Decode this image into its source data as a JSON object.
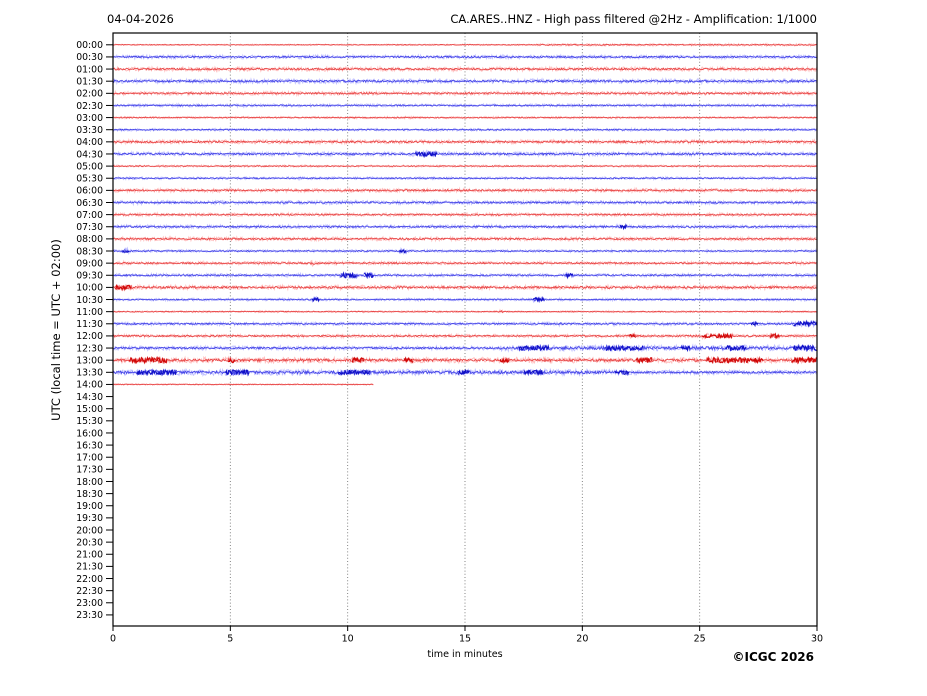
{
  "header": {
    "date": "04-04-2026",
    "title": "CA.ARES..HNZ - High pass filtered @2Hz - Amplification: 1/1000"
  },
  "axes": {
    "x_title": "time in minutes",
    "y_title": "UTC (local time = UTC + 02:00)",
    "x_ticks": [
      "0",
      "5",
      "10",
      "15",
      "20",
      "25",
      "30"
    ],
    "y_ticks": [
      "00:00",
      "00:30",
      "01:00",
      "01:30",
      "02:00",
      "02:30",
      "03:00",
      "03:30",
      "04:00",
      "04:30",
      "05:00",
      "05:30",
      "06:00",
      "06:30",
      "07:00",
      "07:30",
      "08:00",
      "08:30",
      "09:00",
      "09:30",
      "10:00",
      "10:30",
      "11:00",
      "11:30",
      "12:00",
      "12:30",
      "13:00",
      "13:30",
      "14:00",
      "14:30",
      "15:00",
      "15:30",
      "16:00",
      "16:30",
      "17:00",
      "17:30",
      "18:00",
      "18:30",
      "19:00",
      "19:30",
      "20:00",
      "20:30",
      "21:00",
      "21:30",
      "22:00",
      "22:30",
      "23:00",
      "23:30"
    ]
  },
  "footer": {
    "copyright": "©ICGC 2026"
  },
  "chart_data": {
    "type": "line",
    "subtype": "helicorder-seismogram",
    "title": "CA.ARES..HNZ - High pass filtered @2Hz - Amplification: 1/1000",
    "xlabel": "time in minutes",
    "ylabel": "UTC (local time = UTC + 02:00)",
    "x_range_minutes": [
      0,
      30
    ],
    "minutes_per_line": 30,
    "grid_minutes": [
      5,
      10,
      15,
      20,
      25
    ],
    "legend": "none",
    "colors": {
      "red": {
        "core": "#e84848",
        "halo": "#ffb0b0",
        "dark": "#cf0202"
      },
      "blue": {
        "core": "#4848e8",
        "halo": "#b0b0ff",
        "dark": "#0b0bc4"
      }
    },
    "rows": [
      {
        "time": "00:00",
        "color": "red",
        "end_min": 30,
        "noise": 0.4,
        "events": [
          [
            18,
            30,
            0.25
          ]
        ]
      },
      {
        "time": "00:30",
        "color": "blue",
        "end_min": 30,
        "noise": 1.0,
        "events": []
      },
      {
        "time": "01:00",
        "color": "red",
        "end_min": 30,
        "noise": 1.1,
        "events": []
      },
      {
        "time": "01:30",
        "color": "blue",
        "end_min": 30,
        "noise": 1.2,
        "events": []
      },
      {
        "time": "02:00",
        "color": "red",
        "end_min": 30,
        "noise": 1.0,
        "events": []
      },
      {
        "time": "02:30",
        "color": "blue",
        "end_min": 30,
        "noise": 0.8,
        "events": []
      },
      {
        "time": "03:00",
        "color": "red",
        "end_min": 30,
        "noise": 0.6,
        "events": []
      },
      {
        "time": "03:30",
        "color": "blue",
        "end_min": 30,
        "noise": 0.7,
        "events": []
      },
      {
        "time": "04:00",
        "color": "red",
        "end_min": 30,
        "noise": 1.1,
        "events": []
      },
      {
        "time": "04:30",
        "color": "blue",
        "end_min": 30,
        "noise": 1.1,
        "events": [
          [
            12.9,
            13.8,
            1.8
          ]
        ]
      },
      {
        "time": "05:00",
        "color": "red",
        "end_min": 30,
        "noise": 0.6,
        "events": []
      },
      {
        "time": "05:30",
        "color": "blue",
        "end_min": 30,
        "noise": 0.7,
        "events": []
      },
      {
        "time": "06:00",
        "color": "red",
        "end_min": 30,
        "noise": 1.0,
        "events": []
      },
      {
        "time": "06:30",
        "color": "blue",
        "end_min": 30,
        "noise": 1.0,
        "events": []
      },
      {
        "time": "07:00",
        "color": "red",
        "end_min": 30,
        "noise": 0.9,
        "events": []
      },
      {
        "time": "07:30",
        "color": "blue",
        "end_min": 30,
        "noise": 1.0,
        "events": [
          [
            21.6,
            21.9,
            1.3
          ]
        ]
      },
      {
        "time": "08:00",
        "color": "red",
        "end_min": 30,
        "noise": 1.0,
        "events": []
      },
      {
        "time": "08:30",
        "color": "blue",
        "end_min": 30,
        "noise": 0.7,
        "events": [
          [
            0.4,
            0.7,
            1.2
          ],
          [
            12.2,
            12.5,
            1.0
          ]
        ]
      },
      {
        "time": "09:00",
        "color": "red",
        "end_min": 30,
        "noise": 0.9,
        "events": [
          [
            8.4,
            8.6,
            0.8
          ]
        ]
      },
      {
        "time": "09:30",
        "color": "blue",
        "end_min": 30,
        "noise": 0.9,
        "events": [
          [
            9.7,
            10.4,
            2.0
          ],
          [
            10.7,
            11.1,
            1.4
          ],
          [
            19.3,
            19.6,
            1.3
          ]
        ]
      },
      {
        "time": "10:00",
        "color": "red",
        "end_min": 30,
        "noise": 1.2,
        "events": [
          [
            0.1,
            0.8,
            1.9
          ]
        ]
      },
      {
        "time": "10:30",
        "color": "blue",
        "end_min": 30,
        "noise": 0.7,
        "events": [
          [
            8.5,
            8.8,
            1.4
          ],
          [
            17.9,
            18.4,
            1.3
          ]
        ]
      },
      {
        "time": "11:00",
        "color": "red",
        "end_min": 30,
        "noise": 0.5,
        "events": [
          [
            16.4,
            16.6,
            0.7
          ]
        ]
      },
      {
        "time": "11:30",
        "color": "blue",
        "end_min": 30,
        "noise": 0.9,
        "events": [
          [
            19.0,
            19.2,
            0.8
          ],
          [
            27.2,
            27.5,
            1.2
          ],
          [
            29.0,
            30,
            1.8
          ]
        ]
      },
      {
        "time": "12:00",
        "color": "red",
        "end_min": 30,
        "noise": 0.9,
        "events": [
          [
            22.0,
            22.3,
            1.1
          ],
          [
            25.1,
            26.4,
            1.2
          ],
          [
            28.0,
            28.4,
            1.5
          ]
        ]
      },
      {
        "time": "12:30",
        "color": "blue",
        "end_min": 30,
        "noise": 1.1,
        "events": [
          [
            16.5,
            30,
            0.7
          ],
          [
            17.3,
            18.6,
            1.4
          ],
          [
            21.0,
            22.6,
            1.3
          ],
          [
            24.2,
            24.6,
            1.1
          ],
          [
            26.1,
            27.0,
            1.3
          ],
          [
            29.0,
            30,
            1.7
          ]
        ]
      },
      {
        "time": "13:00",
        "color": "red",
        "end_min": 30,
        "noise": 1.5,
        "events": [
          [
            0.7,
            2.3,
            1.7
          ],
          [
            4.9,
            5.2,
            1.3
          ],
          [
            10.2,
            10.7,
            1.2
          ],
          [
            12.4,
            12.8,
            1.1
          ],
          [
            16.5,
            16.9,
            1.1
          ],
          [
            22.3,
            23.0,
            1.4
          ],
          [
            25.3,
            27.7,
            1.4
          ],
          [
            28.9,
            30,
            1.6
          ]
        ]
      },
      {
        "time": "13:30",
        "color": "blue",
        "end_min": 30,
        "noise": 1.2,
        "events": [
          [
            0,
            21.5,
            0.5
          ],
          [
            1.0,
            2.7,
            1.6
          ],
          [
            4.8,
            5.8,
            1.5
          ],
          [
            9.6,
            11.0,
            1.3
          ],
          [
            14.7,
            15.2,
            1.2
          ],
          [
            17.5,
            18.3,
            1.4
          ],
          [
            21.4,
            22.0,
            1.1
          ]
        ]
      },
      {
        "time": "14:00",
        "color": "red",
        "end_min": 11.1,
        "noise": 0.4,
        "events": []
      },
      {
        "time": "14:30",
        "color": "blue",
        "end_min": 0,
        "noise": 0,
        "events": []
      },
      {
        "time": "15:00",
        "color": "red",
        "end_min": 0,
        "noise": 0,
        "events": []
      },
      {
        "time": "15:30",
        "color": "blue",
        "end_min": 0,
        "noise": 0,
        "events": []
      },
      {
        "time": "16:00",
        "color": "red",
        "end_min": 0,
        "noise": 0,
        "events": []
      },
      {
        "time": "16:30",
        "color": "blue",
        "end_min": 0,
        "noise": 0,
        "events": []
      },
      {
        "time": "17:00",
        "color": "red",
        "end_min": 0,
        "noise": 0,
        "events": []
      },
      {
        "time": "17:30",
        "color": "blue",
        "end_min": 0,
        "noise": 0,
        "events": []
      },
      {
        "time": "18:00",
        "color": "red",
        "end_min": 0,
        "noise": 0,
        "events": []
      },
      {
        "time": "18:30",
        "color": "blue",
        "end_min": 0,
        "noise": 0,
        "events": []
      },
      {
        "time": "19:00",
        "color": "red",
        "end_min": 0,
        "noise": 0,
        "events": []
      },
      {
        "time": "19:30",
        "color": "blue",
        "end_min": 0,
        "noise": 0,
        "events": []
      },
      {
        "time": "20:00",
        "color": "red",
        "end_min": 0,
        "noise": 0,
        "events": []
      },
      {
        "time": "20:30",
        "color": "blue",
        "end_min": 0,
        "noise": 0,
        "events": []
      },
      {
        "time": "21:00",
        "color": "red",
        "end_min": 0,
        "noise": 0,
        "events": []
      },
      {
        "time": "21:30",
        "color": "blue",
        "end_min": 0,
        "noise": 0,
        "events": []
      },
      {
        "time": "22:00",
        "color": "red",
        "end_min": 0,
        "noise": 0,
        "events": []
      },
      {
        "time": "22:30",
        "color": "blue",
        "end_min": 0,
        "noise": 0,
        "events": []
      },
      {
        "time": "23:00",
        "color": "red",
        "end_min": 0,
        "noise": 0,
        "events": []
      },
      {
        "time": "23:30",
        "color": "blue",
        "end_min": 0,
        "noise": 0,
        "events": []
      }
    ]
  }
}
